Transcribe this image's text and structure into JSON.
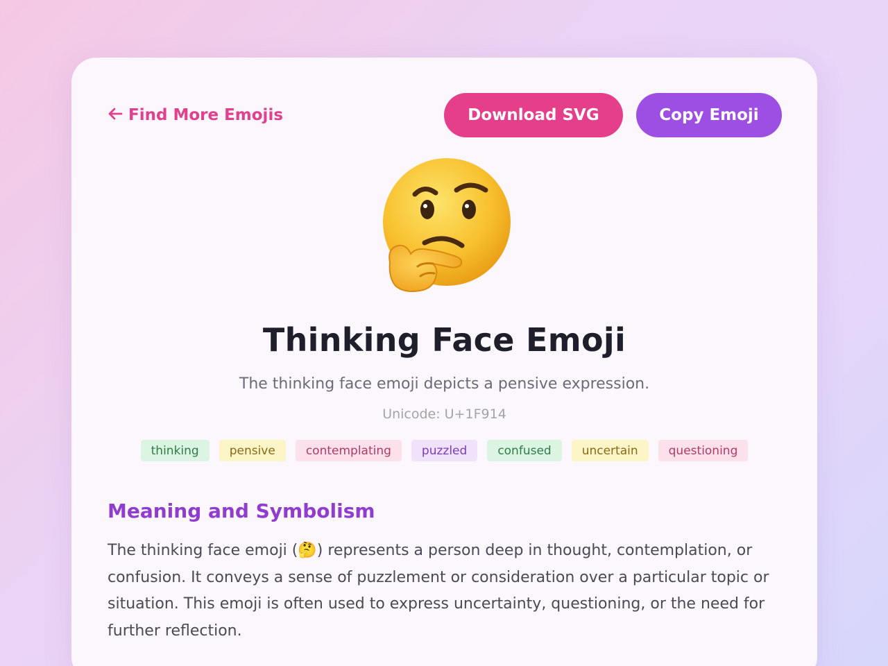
{
  "nav": {
    "back_label": "Find More Emojis"
  },
  "actions": {
    "download_label": "Download SVG",
    "copy_label": "Copy Emoji"
  },
  "emoji": {
    "icon": "thinking-face",
    "title": "Thinking Face Emoji",
    "description": "The thinking face emoji depicts a pensive expression.",
    "unicode": "Unicode: U+1F914"
  },
  "tags": [
    {
      "label": "thinking",
      "color": "#dcf5e3"
    },
    {
      "label": "pensive",
      "color": "#fbf5c8"
    },
    {
      "label": "contemplating",
      "color": "#fce0ea"
    },
    {
      "label": "puzzled",
      "color": "#efe2fa"
    },
    {
      "label": "confused",
      "color": "#dcf5e3"
    },
    {
      "label": "uncertain",
      "color": "#fbf5c8"
    },
    {
      "label": "questioning",
      "color": "#fce0ea"
    }
  ],
  "meaning": {
    "heading": "Meaning and Symbolism",
    "text_before": "The thinking face emoji (",
    "inline_emoji": "🤔",
    "text_after": ") represents a person deep in thought, contemplation, or confusion. It conveys a sense of puzzlement or consideration over a particular topic or situation. This emoji is often used to express uncertainty, questioning, or the need for further reflection."
  },
  "colors": {
    "accent_pink": "#e53f8c",
    "accent_purple": "#9d4fe3",
    "heading_purple": "#8f3ccf"
  }
}
